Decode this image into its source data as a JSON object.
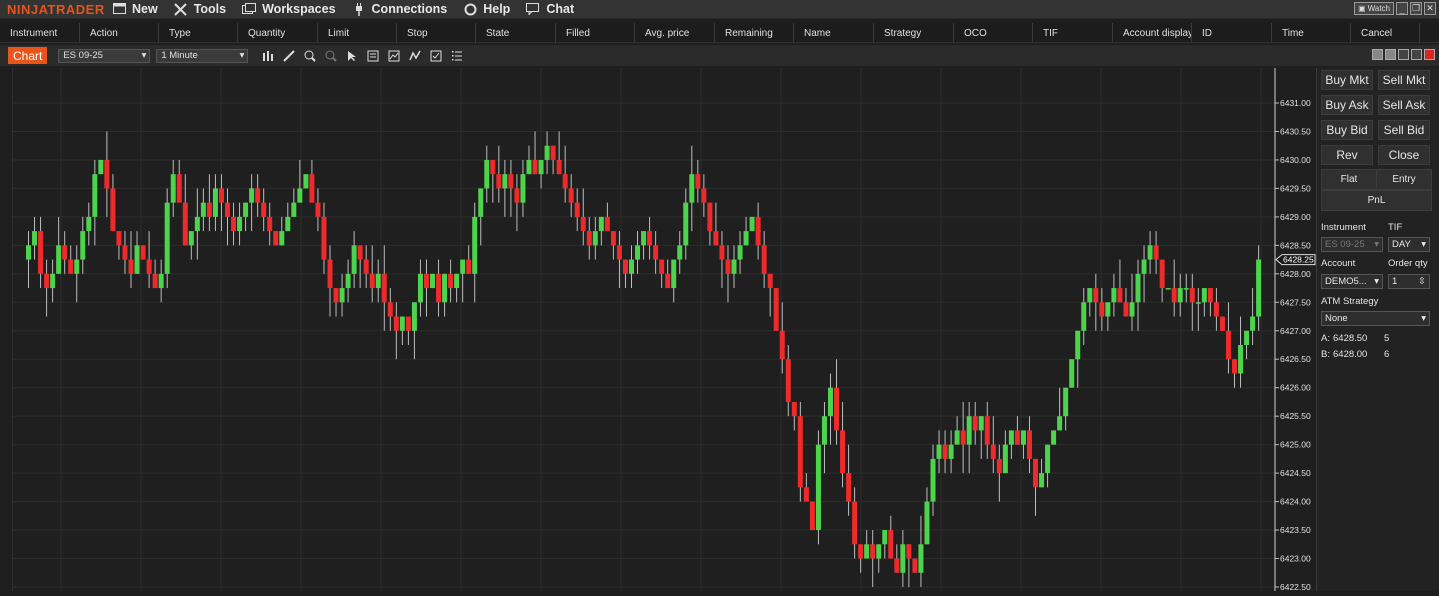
{
  "app": {
    "brand": "NINJATRADER",
    "menu": [
      {
        "label": "New",
        "icon": "new-window-icon"
      },
      {
        "label": "Tools",
        "icon": "tools-icon"
      },
      {
        "label": "Workspaces",
        "icon": "workspaces-icon"
      },
      {
        "label": "Connections",
        "icon": "connections-plug-icon"
      },
      {
        "label": "Help",
        "icon": "help-lifebuoy-icon"
      },
      {
        "label": "Chat",
        "icon": "chat-bubble-icon"
      }
    ],
    "watch_label": "Watch",
    "accent_color": "#e8541a"
  },
  "orders": {
    "columns": [
      "Instrument",
      "Action",
      "Type",
      "Quantity",
      "Limit",
      "Stop",
      "State",
      "Filled",
      "Avg. price",
      "Remaining",
      "Name",
      "Strategy",
      "OCO",
      "TIF",
      "Account display n",
      "ID",
      "Time",
      "Cancel"
    ]
  },
  "chart_toolbar": {
    "tab_label": "Chart",
    "instrument": "ES 09-25",
    "interval": "1 Minute"
  },
  "chart_data": {
    "type": "candlestick",
    "ylim": [
      6422.5,
      6431.5
    ],
    "y_ticks": [
      "6431.00",
      "6430.50",
      "6430.00",
      "6429.50",
      "6429.00",
      "6428.50",
      "6428.00",
      "6427.50",
      "6427.00",
      "6426.50",
      "6426.00",
      "6425.50",
      "6425.00",
      "6424.50",
      "6424.00",
      "6423.50",
      "6423.00",
      "6422.50"
    ],
    "last_price": "6428.25",
    "up_color": "#4cd44c",
    "down_color": "#ee2a2a",
    "closes": [
      6428.5,
      6428.75,
      6428.0,
      6427.75,
      6428.0,
      6428.5,
      6428.25,
      6428.0,
      6428.25,
      6428.75,
      6429.0,
      6429.75,
      6430.0,
      6429.5,
      6428.75,
      6428.5,
      6428.25,
      6428.0,
      6428.5,
      6428.25,
      6428.0,
      6427.75,
      6428.0,
      6429.25,
      6429.75,
      6429.25,
      6428.5,
      6428.75,
      6429.0,
      6429.25,
      6429.0,
      6429.5,
      6429.25,
      6429.0,
      6428.75,
      6429.0,
      6429.25,
      6429.5,
      6429.25,
      6429.0,
      6428.75,
      6428.5,
      6428.75,
      6429.0,
      6429.25,
      6429.5,
      6429.75,
      6429.25,
      6429.0,
      6428.25,
      6427.75,
      6427.5,
      6427.75,
      6428.0,
      6428.5,
      6428.25,
      6428.0,
      6427.75,
      6428.0,
      6427.5,
      6427.25,
      6427.0,
      6427.25,
      6427.0,
      6427.5,
      6428.0,
      6427.75,
      6428.0,
      6427.5,
      6428.0,
      6427.75,
      6428.0,
      6428.25,
      6428.0,
      6429.0,
      6429.5,
      6430.0,
      6429.75,
      6429.5,
      6429.75,
      6429.5,
      6429.25,
      6429.75,
      6430.0,
      6429.75,
      6430.0,
      6430.25,
      6430.0,
      6429.75,
      6429.5,
      6429.25,
      6429.0,
      6428.75,
      6428.5,
      6428.75,
      6429.0,
      6428.75,
      6428.5,
      6428.25,
      6428.0,
      6428.25,
      6428.5,
      6428.75,
      6428.5,
      6428.25,
      6428.0,
      6427.75,
      6428.25,
      6428.5,
      6429.25,
      6429.75,
      6429.5,
      6429.25,
      6428.75,
      6428.5,
      6428.25,
      6428.0,
      6428.25,
      6428.5,
      6428.75,
      6429.0,
      6428.5,
      6428.0,
      6427.75,
      6427.0,
      6426.5,
      6425.75,
      6425.5,
      6424.25,
      6424.0,
      6423.5,
      6425.0,
      6425.5,
      6426.0,
      6425.25,
      6424.5,
      6424.0,
      6423.25,
      6423.0,
      6423.25,
      6423.0,
      6423.25,
      6423.5,
      6423.0,
      6422.75,
      6423.25,
      6423.0,
      6422.75,
      6423.25,
      6424.0,
      6424.75,
      6425.0,
      6424.75,
      6425.0,
      6425.25,
      6425.0,
      6425.5,
      6425.25,
      6425.5,
      6425.0,
      6424.75,
      6424.5,
      6425.0,
      6425.25,
      6425.0,
      6425.25,
      6424.75,
      6424.25,
      6424.5,
      6425.0,
      6425.25,
      6425.5,
      6426.0,
      6426.5,
      6427.0,
      6427.5,
      6427.75,
      6427.5,
      6427.25,
      6427.5,
      6427.75,
      6427.5,
      6427.25,
      6427.5,
      6428.0,
      6428.25,
      6428.5,
      6428.25,
      6427.75,
      6427.75,
      6427.5,
      6427.75,
      6427.75,
      6427.5,
      6427.5,
      6427.75,
      6427.5,
      6427.25,
      6427.0,
      6426.5,
      6426.25,
      6426.75,
      6427.0,
      6427.25,
      6428.25
    ]
  },
  "order_panel": {
    "buy_mkt": "Buy Mkt",
    "sell_mkt": "Sell Mkt",
    "buy_ask": "Buy Ask",
    "sell_ask": "Sell Ask",
    "buy_bid": "Buy Bid",
    "sell_bid": "Sell Bid",
    "rev": "Rev",
    "close": "Close",
    "flat": "Flat",
    "entry": "Entry",
    "pnl": "PnL",
    "instrument_label": "Instrument",
    "tif_label": "TIF",
    "instrument_value": "ES 09-25",
    "tif_value": "DAY",
    "account_label": "Account",
    "order_qty_label": "Order qty",
    "account_value": "DEMO5...",
    "qty_value": "1",
    "atm_label": "ATM Strategy",
    "atm_value": "None",
    "ask_label": "A:",
    "ask_price": "6428.50",
    "ask_size": "5",
    "bid_label": "B:",
    "bid_price": "6428.00",
    "bid_size": "6"
  }
}
